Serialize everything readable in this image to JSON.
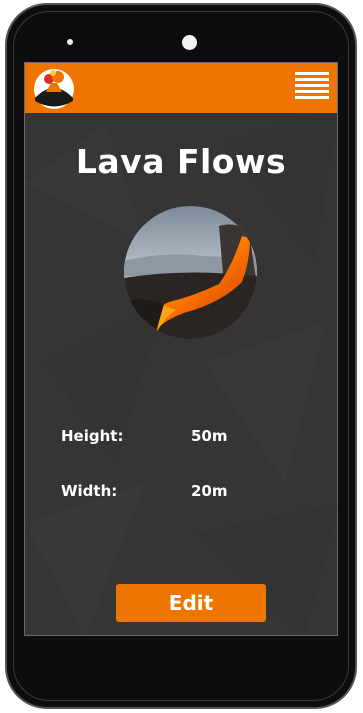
{
  "app": {
    "logo_icon": "volcano-logo-icon",
    "menu_icon": "hamburger-menu-icon",
    "brand_color": "#ee7600",
    "background_color": "#353535"
  },
  "page": {
    "title": "Lava Flows",
    "image_description_icon": "lava-flow-photo"
  },
  "fields": [
    {
      "label": "Height:",
      "value": "50m"
    },
    {
      "label": "Width:",
      "value": "20m"
    }
  ],
  "actions": {
    "edit_label": "Edit"
  }
}
